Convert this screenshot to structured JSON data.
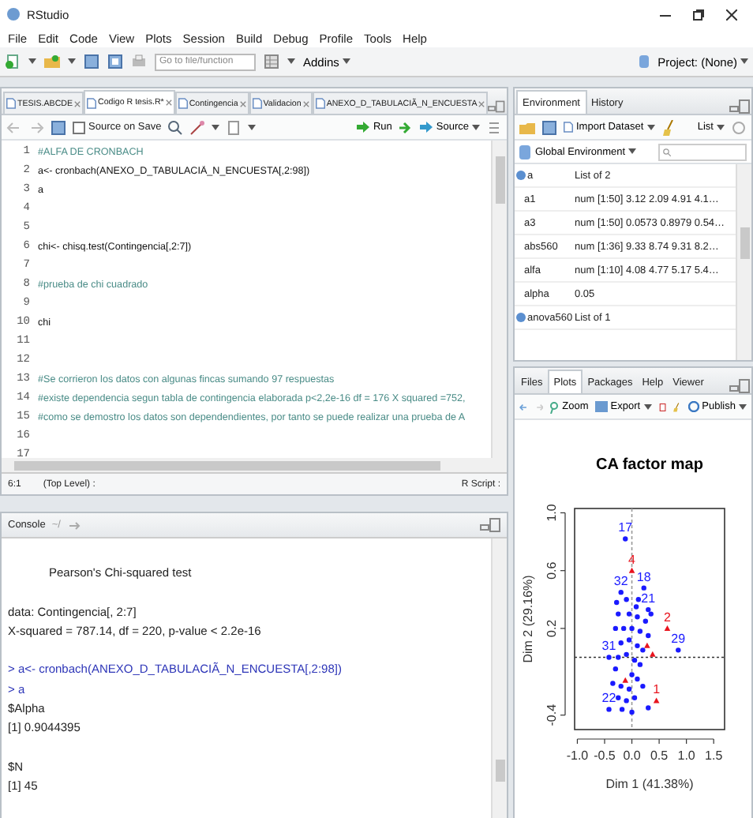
{
  "window": {
    "title": "RStudio"
  },
  "menu": [
    "File",
    "Edit",
    "Code",
    "View",
    "Plots",
    "Session",
    "Build",
    "Debug",
    "Profile",
    "Tools",
    "Help"
  ],
  "toolbar": {
    "search": {
      "placeholder": "Go to file/function"
    },
    "addins": "Addins",
    "project": "Project: (None)"
  },
  "editor": {
    "tabs": [
      {
        "label": "TESIS.ABCDE",
        "selected": false
      },
      {
        "label": "Codigo R tesis.R*",
        "selected": true
      },
      {
        "label": "Contingencia",
        "selected": false
      },
      {
        "label": "Validacion",
        "selected": false
      },
      {
        "label": "ANEXO_D_TABULACIÃ_N_ENCUESTA",
        "selected": false
      }
    ],
    "source_on_save": {
      "label": "Source on Save",
      "checked": false
    },
    "run": "Run",
    "source": "Source",
    "lines": [
      {
        "number": "1",
        "kind": "comment",
        "text": "#ALFA DE CRONBACH"
      },
      {
        "number": "2",
        "kind": "code",
        "text": "a<- cronbach(ANEXO_D_TABULACIÃ_N_ENCUESTA[,2:98])"
      },
      {
        "number": "3",
        "kind": "code",
        "text": "a"
      },
      {
        "number": "4",
        "kind": "blank"
      },
      {
        "number": "5",
        "kind": "blank"
      },
      {
        "number": "6",
        "kind": "code",
        "text": "chi<- chisq.test(Contingencia[,2:7])"
      },
      {
        "number": "7",
        "kind": "blank"
      },
      {
        "number": "8",
        "kind": "comment",
        "text": "#prueba de chi cuadrado"
      },
      {
        "number": "9",
        "kind": "blank"
      },
      {
        "number": "10",
        "kind": "code",
        "text": "chi"
      },
      {
        "number": "11",
        "kind": "blank"
      },
      {
        "number": "12",
        "kind": "blank"
      },
      {
        "number": "13",
        "kind": "comment",
        "text": "#Se corrieron los datos con algunas fincas sumando 97 respuestas"
      },
      {
        "number": "14",
        "kind": "comment",
        "text": "#existe dependencia segun tabla de contingencia elaborada p<2,2e-16 df = 176 X squared =752,"
      },
      {
        "number": "15",
        "kind": "comment",
        "text": "#como se demostro los datos son dependendientes, por tanto se puede realizar una prueba de A"
      },
      {
        "number": "16",
        "kind": "blank"
      },
      {
        "number": "17",
        "kind": "blank"
      }
    ],
    "status": {
      "position": "6:1",
      "scope": "(Top Level) :",
      "type": "R Script :"
    }
  },
  "console": {
    "title": "Console",
    "path": "~/",
    "lines": [
      {
        "kind": "blank"
      },
      {
        "kind": "heading",
        "text": "Pearson's Chi-squared test"
      },
      {
        "kind": "blank"
      },
      {
        "kind": "output",
        "text": "data:  Contingencia[, 2:7]"
      },
      {
        "kind": "output",
        "text": "X-squared = 787.14, df = 220, p-value < 2.2e-16"
      },
      {
        "kind": "blank"
      },
      {
        "kind": "input",
        "text": "> a<- cronbach(ANEXO_D_TABULACIÃ_N_ENCUESTA[,2:98])"
      },
      {
        "kind": "input",
        "text": "> a"
      },
      {
        "kind": "output",
        "text": "$Alpha"
      },
      {
        "kind": "output",
        "text": "[1] 0.9044395"
      },
      {
        "kind": "blank"
      },
      {
        "kind": "output",
        "text": "$N"
      },
      {
        "kind": "output",
        "text": "[1] 45"
      }
    ]
  },
  "environment": {
    "tabs": [
      {
        "label": "Environment",
        "selected": true
      },
      {
        "label": "History",
        "selected": false
      }
    ],
    "import": "Import Dataset",
    "view": "List",
    "scope": "Global Environment",
    "rows": [
      {
        "kind": "list",
        "name": "a",
        "value": "List of 2"
      },
      {
        "kind": "value",
        "name": "a1",
        "value": "num [1:50] 3.12 2.09 4.91 4.1…"
      },
      {
        "kind": "value",
        "name": "a3",
        "value": "num [1:50] 0.0573 0.8979 0.54…"
      },
      {
        "kind": "value",
        "name": "abs560",
        "value": "num [1:36] 9.33 8.74 9.31 8.2…"
      },
      {
        "kind": "value",
        "name": "alfa",
        "value": "num [1:10] 4.08 4.77 5.17 5.4…"
      },
      {
        "kind": "value",
        "name": "alpha",
        "value": "0.05"
      },
      {
        "kind": "list",
        "name": "anova560",
        "value": "List of 1"
      }
    ]
  },
  "plots": {
    "tabs": [
      {
        "label": "Files",
        "selected": false
      },
      {
        "label": "Plots",
        "selected": true
      },
      {
        "label": "Packages",
        "selected": false
      },
      {
        "label": "Help",
        "selected": false
      },
      {
        "label": "Viewer",
        "selected": false
      }
    ],
    "zoom": "Zoom",
    "export": "Export",
    "publish": "Publish",
    "chart_data": {
      "type": "scatter",
      "title": "CA factor map",
      "xlabel": "Dim 1 (41.38%)",
      "ylabel": "Dim 2 (29.16%)",
      "xlim": [
        -1.05,
        1.7
      ],
      "ylim": [
        -0.5,
        1.03
      ],
      "xticks": [
        {
          "value": -1,
          "label": "-1.0"
        },
        {
          "value": -0.5,
          "label": "-0.5"
        },
        {
          "value": 0,
          "label": "0.0"
        },
        {
          "value": 0.5,
          "label": "0.5"
        },
        {
          "value": 1,
          "label": "1.0"
        },
        {
          "value": 1.5,
          "label": "1.5"
        }
      ],
      "yticks": [
        {
          "value": -0.4,
          "label": "-0.4"
        },
        {
          "value": 0.2,
          "label": "0.2"
        },
        {
          "value": 0.6,
          "label": "0.6"
        },
        {
          "value": 1,
          "label": "1.0"
        }
      ],
      "ref_lines": [
        {
          "axis": "y",
          "value": 0
        },
        {
          "axis": "x",
          "value": 0
        }
      ],
      "series": [
        {
          "color": "#1a1aff",
          "x": [
            -0.12,
            -0.2,
            -0.1,
            0.08,
            0.12,
            -0.25,
            -0.05,
            0.1,
            0.25,
            -0.3,
            -0.15,
            0,
            0.15,
            0.3,
            -0.2,
            -0.05,
            0.1,
            0.2,
            0.85,
            -0.42,
            -0.25,
            -0.1,
            0.05,
            0.15,
            -0.3,
            0,
            0.1,
            -0.35,
            -0.2,
            -0.05,
            0.2,
            -0.25,
            -0.1,
            0.05,
            -0.42,
            -0.18,
            0.3,
            0,
            0.35,
            -0.28,
            0.22,
            0.3
          ],
          "values": [
            0.82,
            0.45,
            0.4,
            0.35,
            0.4,
            0.3,
            0.3,
            0.28,
            0.25,
            0.2,
            0.2,
            0.2,
            0.18,
            0.15,
            0.1,
            0.12,
            0.08,
            0.05,
            0.05,
            0,
            0,
            0.02,
            -0.02,
            -0.05,
            -0.08,
            -0.12,
            -0.15,
            -0.18,
            -0.2,
            -0.22,
            -0.2,
            -0.28,
            -0.3,
            -0.28,
            -0.36,
            -0.36,
            -0.35,
            -0.38,
            0.3,
            0.38,
            0.48,
            0.33
          ]
        },
        {
          "color": "#e8141e",
          "x": [
            0,
            0.65,
            0.45,
            0.38,
            -0.12,
            0.28
          ],
          "values": [
            0.6,
            0.2,
            -0.3,
            0.02,
            -0.16,
            0.08
          ]
        }
      ],
      "annotations": [
        {
          "x": -0.12,
          "y": 0.82,
          "text": "17"
        },
        {
          "x": 0,
          "y": 0.6,
          "text": "4"
        },
        {
          "x": 0.22,
          "y": 0.48,
          "text": "18"
        },
        {
          "x": -0.2,
          "y": 0.45,
          "text": "32"
        },
        {
          "x": 0.3,
          "y": 0.33,
          "text": "21"
        },
        {
          "x": 0.65,
          "y": 0.2,
          "text": "2"
        },
        {
          "x": 0.85,
          "y": 0.05,
          "text": "29"
        },
        {
          "x": -0.42,
          "y": 0,
          "text": "31"
        },
        {
          "x": -0.42,
          "y": -0.36,
          "text": "22"
        },
        {
          "x": 0.45,
          "y": -0.3,
          "text": "1"
        }
      ]
    }
  }
}
